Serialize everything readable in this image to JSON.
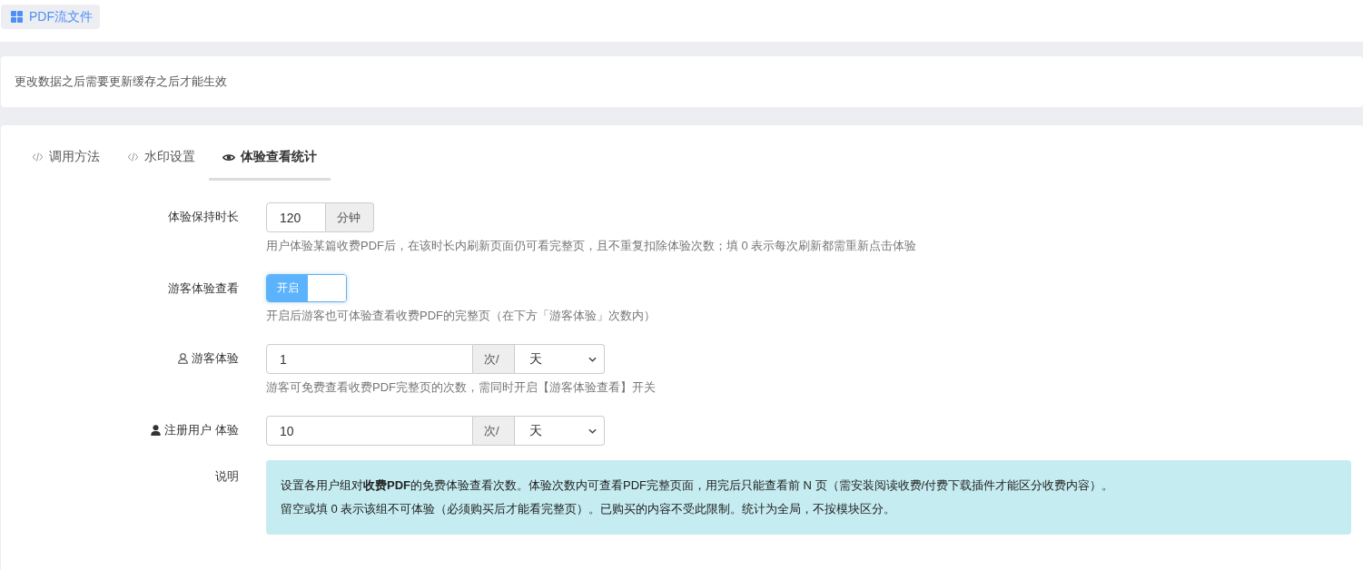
{
  "top_tab": {
    "label": "PDF流文件",
    "selected": true
  },
  "notice": "更改数据之后需要更新缓存之后才能生效",
  "tabs": [
    {
      "kind": "code",
      "label": "调用方法",
      "selected": false
    },
    {
      "kind": "code",
      "label": "水印设置",
      "selected": false
    },
    {
      "kind": "stats",
      "label": "体验查看统计",
      "selected": true
    }
  ],
  "form": {
    "rows": [
      {
        "kind": "addon_input",
        "label": "体验保持时长",
        "value": "120",
        "addon": "分钟",
        "help": "用户体验某篇收费PDF后，在该时长内刷新页面仍可看完整页，且不重复扣除体验次数；填 0 表示每次刷新都需重新点击体验"
      },
      {
        "kind": "toggle",
        "label": "游客体验查看",
        "on": true,
        "on_text": "开启",
        "help": "开启后游客也可体验查看收费PDF的完整页（在下方「游客体验」次数内）"
      },
      {
        "kind": "guest_quota",
        "label": "游客体验",
        "value": "1",
        "addon": "次/",
        "period": "天",
        "help": "游客可免费查看收费PDF完整页的次数，需同时开启【游客体验查看】开关"
      },
      {
        "kind": "member_quota",
        "label": "注册用户 体验",
        "value": "10",
        "addon": "次/",
        "period": "天"
      },
      {
        "kind": "note",
        "label": "说明",
        "notes": [
          "设置各用户组对**收费PDF**的免费体验查看次数。体验次数内可查看PDF完整页面，用完后只能查看前 N 页（需安装阅读收费/付费下载插件才能区分收费内容）。",
          "留空或填 0 表示该组不可体验（必须购买后才能看完整页）。已购买的内容不受此限制。统计为全局，不按模块区分。"
        ]
      }
    ]
  }
}
